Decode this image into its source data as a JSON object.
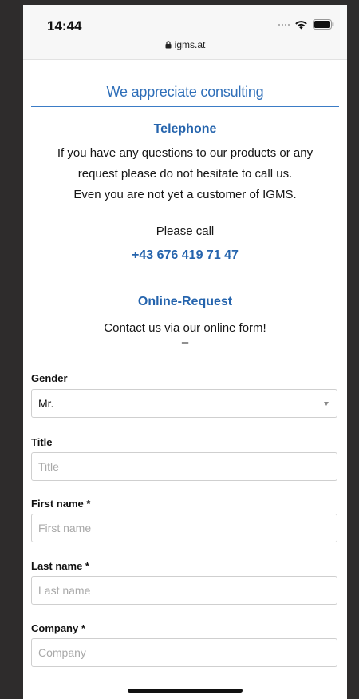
{
  "status_bar": {
    "time": "14:44",
    "url": "igms.at",
    "icons": [
      "signal-icon",
      "wifi-icon",
      "battery-icon",
      "lock-icon"
    ]
  },
  "header": {
    "section_title": "We appreciate consulting"
  },
  "telephone": {
    "heading": "Telephone",
    "text_lines": [
      "If you have any questions to our products or any",
      "request please do not hesitate to call us.",
      "Even you are not yet a customer of IGMS."
    ],
    "call_label": "Please call",
    "number": "+43 676 419 71 47"
  },
  "online_request": {
    "heading": "Online-Request",
    "text": "Contact us via our online form!",
    "divider": "–"
  },
  "form": {
    "gender": {
      "label": "Gender",
      "value": "Mr."
    },
    "title": {
      "label": "Title",
      "placeholder": "Title"
    },
    "first_name": {
      "label": "First name *",
      "placeholder": "First name"
    },
    "last_name": {
      "label": "Last name *",
      "placeholder": "Last name"
    },
    "company": {
      "label": "Company *",
      "placeholder": "Company"
    }
  },
  "colors": {
    "accent": "#2564ad",
    "rule": "#3b7cc6",
    "background_outer": "#2e2c2c"
  }
}
